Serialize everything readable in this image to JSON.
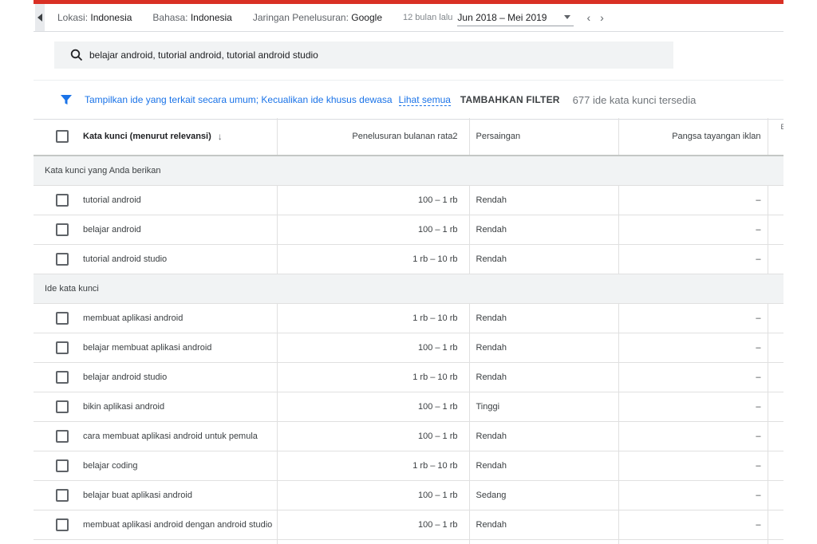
{
  "topbar": {
    "location_label": "Lokasi:",
    "location_value": "Indonesia",
    "language_label": "Bahasa:",
    "language_value": "Indonesia",
    "network_label": "Jaringan Penelusuran:",
    "network_value": "Google",
    "range_label": "12 bulan lalu",
    "date_range": "Jun 2018 – Mei 2019"
  },
  "search": {
    "value": "belajar android, tutorial android, tutorial android studio"
  },
  "filters": {
    "text": "Tampilkan ide yang terkait secara umum; Kecualikan ide khusus dewasa",
    "see_all": "Lihat semua",
    "add_filter": "TAMBAHKAN FILTER",
    "count": "677 ide kata kunci tersedia"
  },
  "table": {
    "headers": {
      "keyword": "Kata kunci (menurut relevansi)",
      "searches": "Penelusuran bulanan rata2",
      "competition": "Persaingan",
      "impression_share": "Pangsa tayangan iklan",
      "cut": "E"
    },
    "groups": [
      {
        "title": "Kata kunci yang Anda berikan",
        "rows": [
          {
            "keyword": "tutorial android",
            "searches": "100 – 1 rb",
            "competition": "Rendah",
            "share": "–"
          },
          {
            "keyword": "belajar android",
            "searches": "100 – 1 rb",
            "competition": "Rendah",
            "share": "–"
          },
          {
            "keyword": "tutorial android studio",
            "searches": "1 rb – 10 rb",
            "competition": "Rendah",
            "share": "–"
          }
        ]
      },
      {
        "title": "Ide kata kunci",
        "rows": [
          {
            "keyword": "membuat aplikasi android",
            "searches": "1 rb – 10 rb",
            "competition": "Rendah",
            "share": "–"
          },
          {
            "keyword": "belajar membuat aplikasi android",
            "searches": "100 – 1 rb",
            "competition": "Rendah",
            "share": "–"
          },
          {
            "keyword": "belajar android studio",
            "searches": "1 rb – 10 rb",
            "competition": "Rendah",
            "share": "–"
          },
          {
            "keyword": "bikin aplikasi android",
            "searches": "100 – 1 rb",
            "competition": "Tinggi",
            "share": "–"
          },
          {
            "keyword": "cara membuat aplikasi android untuk pemula",
            "searches": "100 – 1 rb",
            "competition": "Rendah",
            "share": "–"
          },
          {
            "keyword": "belajar coding",
            "searches": "1 rb – 10 rb",
            "competition": "Rendah",
            "share": "–"
          },
          {
            "keyword": "belajar buat aplikasi android",
            "searches": "100 – 1 rb",
            "competition": "Sedang",
            "share": "–"
          },
          {
            "keyword": "membuat aplikasi android dengan android studio",
            "searches": "100 – 1 rb",
            "competition": "Rendah",
            "share": "–"
          }
        ]
      }
    ]
  },
  "colors": {
    "accent_red": "#d93025",
    "link_blue": "#1a73e8",
    "group_bg": "#f1f3f4"
  },
  "icons": {
    "back": "triangle-left-icon",
    "search": "search-icon",
    "filter": "filter-funnel-icon",
    "dropdown": "caret-down-icon"
  }
}
